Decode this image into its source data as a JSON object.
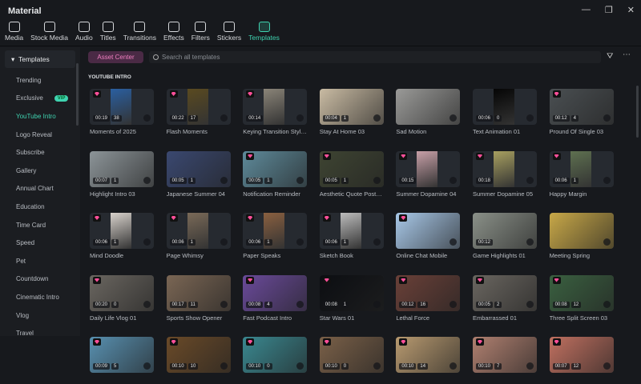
{
  "window": {
    "title": "Material",
    "minimize": "—",
    "maximize": "❐",
    "close": "✕"
  },
  "toolbar": [
    {
      "label": "Media",
      "icon": "media-icon"
    },
    {
      "label": "Stock Media",
      "icon": "stock-media-icon"
    },
    {
      "label": "Audio",
      "icon": "audio-icon"
    },
    {
      "label": "Titles",
      "icon": "titles-icon"
    },
    {
      "label": "Transitions",
      "icon": "transitions-icon"
    },
    {
      "label": "Effects",
      "icon": "effects-icon"
    },
    {
      "label": "Filters",
      "icon": "filters-icon"
    },
    {
      "label": "Stickers",
      "icon": "stickers-icon"
    },
    {
      "label": "Templates",
      "icon": "templates-icon",
      "active": true
    }
  ],
  "sidebar": {
    "header": "Templates",
    "vip_badge": "VIP",
    "items": [
      "Trending",
      "Exclusive",
      "YouTube Intro",
      "Logo Reveal",
      "Subscribe",
      "Gallery",
      "Annual Chart",
      "Education",
      "Time Card",
      "Speed",
      "Pet",
      "Countdown",
      "Cinematic Intro",
      "Vlog",
      "Travel"
    ],
    "active": "YouTube Intro"
  },
  "main": {
    "asset_center": "Asset Center",
    "search_placeholder": "Search all templates",
    "section_title": "YOUTUBE INTRO",
    "filter_icon": "⛛",
    "more_icon": "⋯"
  },
  "colors": {
    "accent": "#3fd3b0",
    "premium": "#ff4f9a",
    "asset_center": "#f07fc0"
  },
  "templates": [
    {
      "name": "Moments of 2025",
      "duration": "00:19",
      "count": "38",
      "premium": true,
      "c": "#2a5fa0"
    },
    {
      "name": "Flash Moments",
      "duration": "00:22",
      "count": "17",
      "premium": true,
      "c": "#5a4a20"
    },
    {
      "name": "Keying Transition Style...",
      "duration": "00:14",
      "count": "",
      "premium": true,
      "c": "#8a8478"
    },
    {
      "name": "Stay At Home 03",
      "duration": "00:04",
      "count": "1",
      "premium": false,
      "c": "#c9bba3",
      "full": true
    },
    {
      "name": "Sad Motion",
      "duration": "",
      "count": "",
      "premium": false,
      "c": "#9a9a98",
      "full": true
    },
    {
      "name": "Text Animation 01",
      "duration": "00:06",
      "count": "0",
      "premium": false,
      "c": "#050505"
    },
    {
      "name": "Pround Of Single 03",
      "duration": "00:12",
      "count": "4",
      "premium": true,
      "c": "#4a4f52",
      "full": true
    },
    {
      "name": "Highlight Intro 03",
      "duration": "00:07",
      "count": "1",
      "premium": false,
      "c": "#8c9498",
      "full": true
    },
    {
      "name": "Japanese Summer 04",
      "duration": "00:05",
      "count": "1",
      "premium": false,
      "c": "#3a4870",
      "full": true
    },
    {
      "name": "Notification Reminder",
      "duration": "00:05",
      "count": "1",
      "premium": true,
      "c": "#5e8a9a",
      "full": true
    },
    {
      "name": "Aesthetic Quote Post 01",
      "duration": "00:05",
      "count": "1",
      "premium": true,
      "c": "#3e4432",
      "full": true
    },
    {
      "name": "Summer Dopamine 04",
      "duration": "00:15",
      "count": "",
      "premium": true,
      "c": "#c8a0a8"
    },
    {
      "name": "Summer Dopamine 05",
      "duration": "00:18",
      "count": "",
      "premium": true,
      "c": "#a8a060"
    },
    {
      "name": "Happy Margin",
      "duration": "00:06",
      "count": "1",
      "premium": true,
      "c": "#5e7050"
    },
    {
      "name": "Mind Doodle",
      "duration": "00:06",
      "count": "1",
      "premium": true,
      "c": "#d8d2cc"
    },
    {
      "name": "Page Whimsy",
      "duration": "00:06",
      "count": "1",
      "premium": true,
      "c": "#7a6a58"
    },
    {
      "name": "Paper Speaks",
      "duration": "00:06",
      "count": "1",
      "premium": true,
      "c": "#8a6040"
    },
    {
      "name": "Sketch Book",
      "duration": "00:06",
      "count": "1",
      "premium": true,
      "c": "#bcbcbc"
    },
    {
      "name": "Online Chat Mobile",
      "duration": "",
      "count": "",
      "premium": true,
      "c": "#a8c8e8",
      "full": true
    },
    {
      "name": "Game Highlights 01",
      "duration": "00:12",
      "count": "",
      "premium": false,
      "c": "#8a9088",
      "full": true
    },
    {
      "name": "Meeting Spring",
      "duration": "",
      "count": "",
      "premium": false,
      "c": "#c8a848",
      "full": true
    },
    {
      "name": "Daily Life Vlog 01",
      "duration": "00:20",
      "count": "0",
      "premium": true,
      "c": "#6a6660",
      "full": true
    },
    {
      "name": "Sports Show Opener",
      "duration": "00:17",
      "count": "11",
      "premium": false,
      "c": "#7a6654",
      "full": true
    },
    {
      "name": "Fast Podcast Intro",
      "duration": "00:08",
      "count": "4",
      "premium": true,
      "c": "#6a4a9a",
      "full": true
    },
    {
      "name": "Star Wars 01",
      "duration": "00:08",
      "count": "1",
      "premium": true,
      "c": "#0c0e12",
      "full": true
    },
    {
      "name": "Lethal Force",
      "duration": "00:12",
      "count": "16",
      "premium": true,
      "c": "#6a4038",
      "full": true
    },
    {
      "name": "Embarrassed 01",
      "duration": "00:05",
      "count": "2",
      "premium": true,
      "c": "#6a6660",
      "full": true
    },
    {
      "name": "Three Split Screen 03",
      "duration": "00:08",
      "count": "12",
      "premium": true,
      "c": "#3a6040",
      "full": true
    },
    {
      "name": "",
      "duration": "00:09",
      "count": "5",
      "premium": true,
      "c": "#5890b0",
      "full": true
    },
    {
      "name": "",
      "duration": "00:10",
      "count": "10",
      "premium": true,
      "c": "#6a4a28",
      "full": true
    },
    {
      "name": "",
      "duration": "00:10",
      "count": "0",
      "premium": true,
      "c": "#3a8890",
      "full": true
    },
    {
      "name": "",
      "duration": "00:10",
      "count": "0",
      "premium": true,
      "c": "#7a6048",
      "full": true
    },
    {
      "name": "",
      "duration": "00:10",
      "count": "14",
      "premium": true,
      "c": "#b89a70",
      "full": true
    },
    {
      "name": "",
      "duration": "00:10",
      "count": "7",
      "premium": true,
      "c": "#b08070",
      "full": true
    },
    {
      "name": "",
      "duration": "00:07",
      "count": "12",
      "premium": true,
      "c": "#c07060",
      "full": true
    }
  ]
}
